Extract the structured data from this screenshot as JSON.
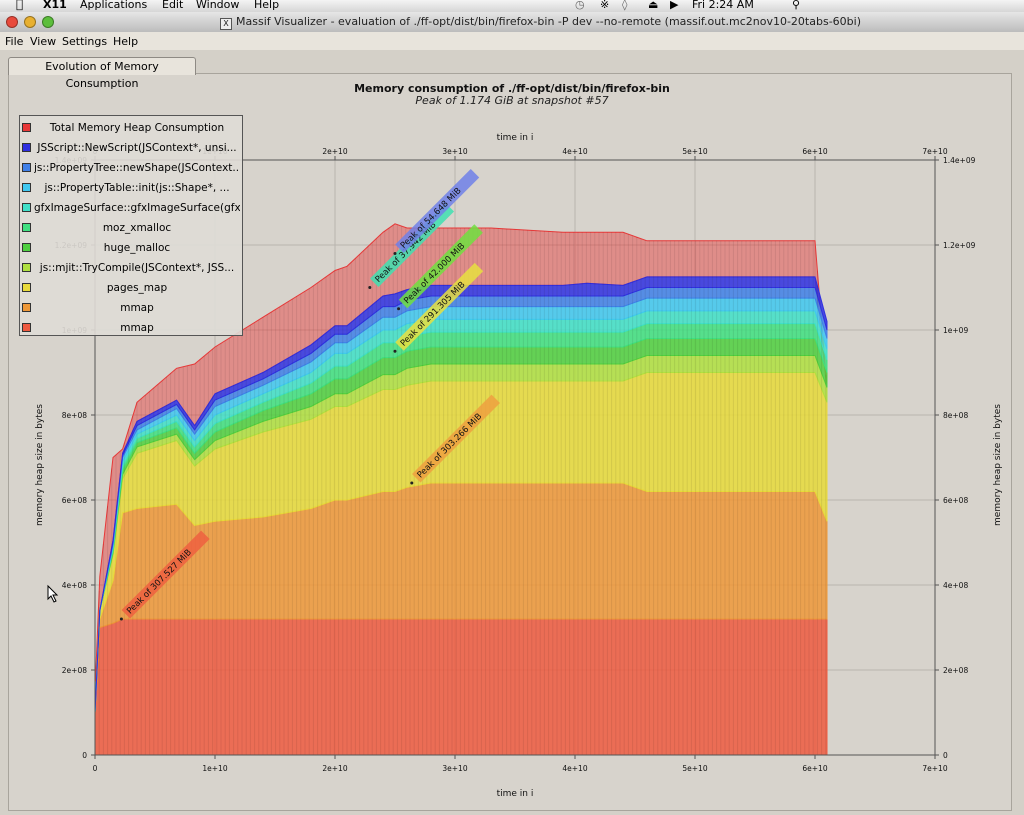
{
  "menubar": {
    "app": "X11",
    "items": [
      "Applications",
      "Edit",
      "Window",
      "Help"
    ],
    "clock": "Fri 2:24 AM"
  },
  "window": {
    "title": "Massif Visualizer - evaluation of ./ff-opt/dist/bin/firefox-bin -P dev --no-remote (massif.out.mc2nov10-20tabs-60bi)"
  },
  "appmenu": [
    "File",
    "View",
    "Settings",
    "Help"
  ],
  "tab": "Evolution of Memory Consumption",
  "chart_data": {
    "type": "area",
    "title": "Memory consumption of ./ff-opt/dist/bin/firefox-bin",
    "subtitle": "Peak of 1.174 GiB at snapshot #57",
    "xlabel_top": "time in i",
    "xlabel_bottom": "time in i",
    "ylabel_left": "memory heap size in bytes",
    "ylabel_right": "memory heap size in bytes",
    "xlim": [
      0,
      70000000000
    ],
    "ylim": [
      0,
      1400000000
    ],
    "x_ticks": [
      "0",
      "1e+10",
      "2e+10",
      "3e+10",
      "4e+10",
      "5e+10",
      "6e+10",
      "7e+10"
    ],
    "y_ticks": [
      "0",
      "2e+08",
      "4e+08",
      "6e+08",
      "8e+08",
      "1e+09",
      "1.2e+09",
      "1.4e+09"
    ],
    "x": [
      0,
      400000000,
      1500000000,
      2300000000,
      3500000000,
      6800000000,
      8300000000,
      10000000000,
      14000000000,
      18000000000,
      20000000000,
      21000000000,
      24000000000,
      25000000000,
      26000000000,
      28000000000,
      33000000000,
      39000000000,
      41000000000,
      44000000000,
      46000000000,
      60000000000,
      61000000000
    ],
    "series": [
      {
        "name": "mmap",
        "color": "#ee5a40",
        "values": [
          100000000,
          300000000,
          310000000,
          320000000,
          320000000,
          320000000,
          320000000,
          320000000,
          320000000,
          320000000,
          320000000,
          320000000,
          320000000,
          320000000,
          320000000,
          320000000,
          320000000,
          320000000,
          320000000,
          320000000,
          320000000,
          320000000,
          320000000
        ]
      },
      {
        "name": "mmap",
        "color": "#ee9838",
        "values": [
          0,
          20000000,
          100000000,
          250000000,
          260000000,
          270000000,
          220000000,
          230000000,
          240000000,
          260000000,
          280000000,
          280000000,
          300000000,
          300000000,
          310000000,
          320000000,
          320000000,
          320000000,
          320000000,
          320000000,
          300000000,
          300000000,
          230000000
        ]
      },
      {
        "name": "pages_map",
        "color": "#e8da3a",
        "values": [
          0,
          20000000,
          60000000,
          80000000,
          130000000,
          150000000,
          140000000,
          170000000,
          200000000,
          210000000,
          220000000,
          220000000,
          240000000,
          240000000,
          240000000,
          240000000,
          240000000,
          240000000,
          240000000,
          240000000,
          280000000,
          280000000,
          280000000
        ]
      },
      {
        "name": "js::mjit::TryCompile(JSContext*, JSS...",
        "color": "#b0e040",
        "values": [
          0,
          0,
          5000000,
          10000000,
          15000000,
          15000000,
          15000000,
          20000000,
          25000000,
          30000000,
          30000000,
          30000000,
          35000000,
          35000000,
          40000000,
          40000000,
          40000000,
          40000000,
          40000000,
          40000000,
          40000000,
          40000000,
          35000000
        ]
      },
      {
        "name": "huge_malloc",
        "color": "#50d040",
        "values": [
          0,
          0,
          5000000,
          10000000,
          10000000,
          15000000,
          15000000,
          20000000,
          25000000,
          30000000,
          35000000,
          35000000,
          40000000,
          40000000,
          40000000,
          40000000,
          40000000,
          40000000,
          40000000,
          40000000,
          40000000,
          40000000,
          35000000
        ]
      },
      {
        "name": "moz_xmalloc",
        "color": "#40e080",
        "values": [
          0,
          0,
          5000000,
          10000000,
          10000000,
          15000000,
          15000000,
          20000000,
          20000000,
          25000000,
          30000000,
          30000000,
          35000000,
          35000000,
          35000000,
          35000000,
          35000000,
          35000000,
          35000000,
          35000000,
          35000000,
          35000000,
          30000000
        ]
      },
      {
        "name": "gfxImageSurface::gfxImageSurface(gfx...",
        "color": "#40e0c8",
        "values": [
          0,
          0,
          5000000,
          10000000,
          10000000,
          15000000,
          15000000,
          20000000,
          20000000,
          25000000,
          30000000,
          30000000,
          30000000,
          30000000,
          30000000,
          30000000,
          30000000,
          30000000,
          30000000,
          30000000,
          30000000,
          30000000,
          25000000
        ]
      },
      {
        "name": "js::PropertyTable::init(js::Shape*, ...",
        "color": "#40c8f0",
        "values": [
          0,
          0,
          5000000,
          10000000,
          10000000,
          15000000,
          15000000,
          20000000,
          20000000,
          25000000,
          25000000,
          25000000,
          30000000,
          30000000,
          30000000,
          30000000,
          30000000,
          30000000,
          30000000,
          30000000,
          30000000,
          30000000,
          25000000
        ]
      },
      {
        "name": "js::PropertyTree::newShape(JSContext...",
        "color": "#4080e8",
        "values": [
          0,
          0,
          5000000,
          5000000,
          10000000,
          10000000,
          10000000,
          15000000,
          15000000,
          20000000,
          20000000,
          20000000,
          25000000,
          25000000,
          25000000,
          25000000,
          25000000,
          25000000,
          25000000,
          25000000,
          25000000,
          25000000,
          20000000
        ]
      },
      {
        "name": "JSScript::NewScript(JSContext*, unsi...",
        "color": "#3030e0",
        "values": [
          0,
          0,
          5000000,
          5000000,
          10000000,
          10000000,
          10000000,
          15000000,
          15000000,
          20000000,
          20000000,
          20000000,
          25000000,
          30000000,
          25000000,
          25000000,
          25000000,
          25000000,
          30000000,
          25000000,
          25000000,
          25000000,
          20000000
        ]
      }
    ],
    "total": {
      "name": "Total Memory Heap Consumption",
      "color": "#e83838",
      "values": [
        150000000,
        420000000,
        700000000,
        720000000,
        830000000,
        910000000,
        920000000,
        960000000,
        1030000000,
        1100000000,
        1140000000,
        1150000000,
        1230000000,
        1250000000,
        1240000000,
        1240000000,
        1240000000,
        1230000000,
        1230000000,
        1230000000,
        1210000000,
        1210000000,
        860000000
      ]
    },
    "annotations": [
      {
        "text": "Peak of 307.527 MiB",
        "x": 2200000000,
        "y": 320000000,
        "color": "#ee6040"
      },
      {
        "text": "Peak of 303.266 MiB",
        "x": 26400000000,
        "y": 640000000,
        "color": "#eea040"
      },
      {
        "text": "Peak of 291.305 MiB",
        "x": 25000000000,
        "y": 950000000,
        "color": "#e8e040"
      },
      {
        "text": "Peak of 42.000 MiB",
        "x": 25300000000,
        "y": 1050000000,
        "color": "#70e040"
      },
      {
        "text": "Peak of 37.942 MiB",
        "x": 22900000000,
        "y": 1100000000,
        "color": "#40e0b0"
      },
      {
        "text": "Peak of 54.648 MiB",
        "x": 25000000000,
        "y": 1180000000,
        "color": "#7080e8"
      }
    ]
  }
}
